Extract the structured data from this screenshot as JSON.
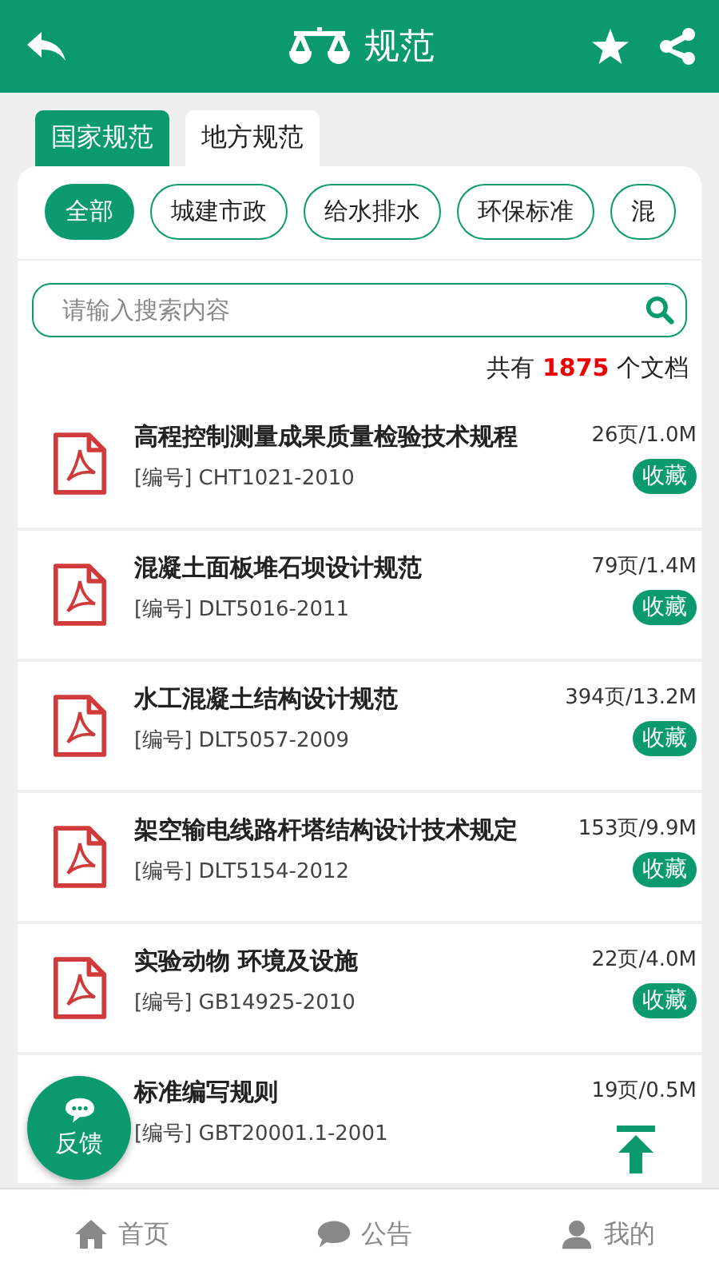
{
  "header": {
    "title": "规范"
  },
  "tabs": [
    {
      "label": "国家规范",
      "selected": true
    },
    {
      "label": "地方规范",
      "selected": false
    }
  ],
  "chips": [
    {
      "label": "全部",
      "selected": true
    },
    {
      "label": "城建市政",
      "selected": false
    },
    {
      "label": "给水排水",
      "selected": false
    },
    {
      "label": "环保标准",
      "selected": false
    },
    {
      "label": "混",
      "selected": false
    }
  ],
  "search": {
    "placeholder": "请输入搜索内容"
  },
  "count": {
    "prefix": "共有",
    "number": "1875",
    "suffix": "个文档"
  },
  "documents": [
    {
      "kind": "pdf",
      "title": "高程控制测量成果质量检验技术规程",
      "code": "[编号] CHT1021-2010",
      "size": "26页/1.0M",
      "collect": "收藏"
    },
    {
      "kind": "pdf",
      "title": "混凝土面板堆石坝设计规范",
      "code": "[编号] DLT5016-2011",
      "size": "79页/1.4M",
      "collect": "收藏"
    },
    {
      "kind": "pdf",
      "title": "水工混凝土结构设计规范",
      "code": "[编号] DLT5057-2009",
      "size": "394页/13.2M",
      "collect": "收藏"
    },
    {
      "kind": "pdf",
      "title": "架空输电线路杆塔结构设计技术规定",
      "code": "[编号] DLT5154-2012",
      "size": "153页/9.9M",
      "collect": "收藏"
    },
    {
      "kind": "pdf",
      "title": "实验动物 环境及设施",
      "code": "[编号] GB14925-2010",
      "size": "22页/4.0M",
      "collect": "收藏"
    },
    {
      "kind": "covered",
      "title": "标准编写规则",
      "code": "[编号] GBT20001.1-2001",
      "size": "19页/0.5M"
    }
  ],
  "feedback": {
    "label": "反馈"
  },
  "nav": [
    {
      "label": "首页",
      "kind": "home"
    },
    {
      "label": "公告",
      "kind": "notice"
    },
    {
      "label": "我的",
      "kind": "me"
    }
  ]
}
